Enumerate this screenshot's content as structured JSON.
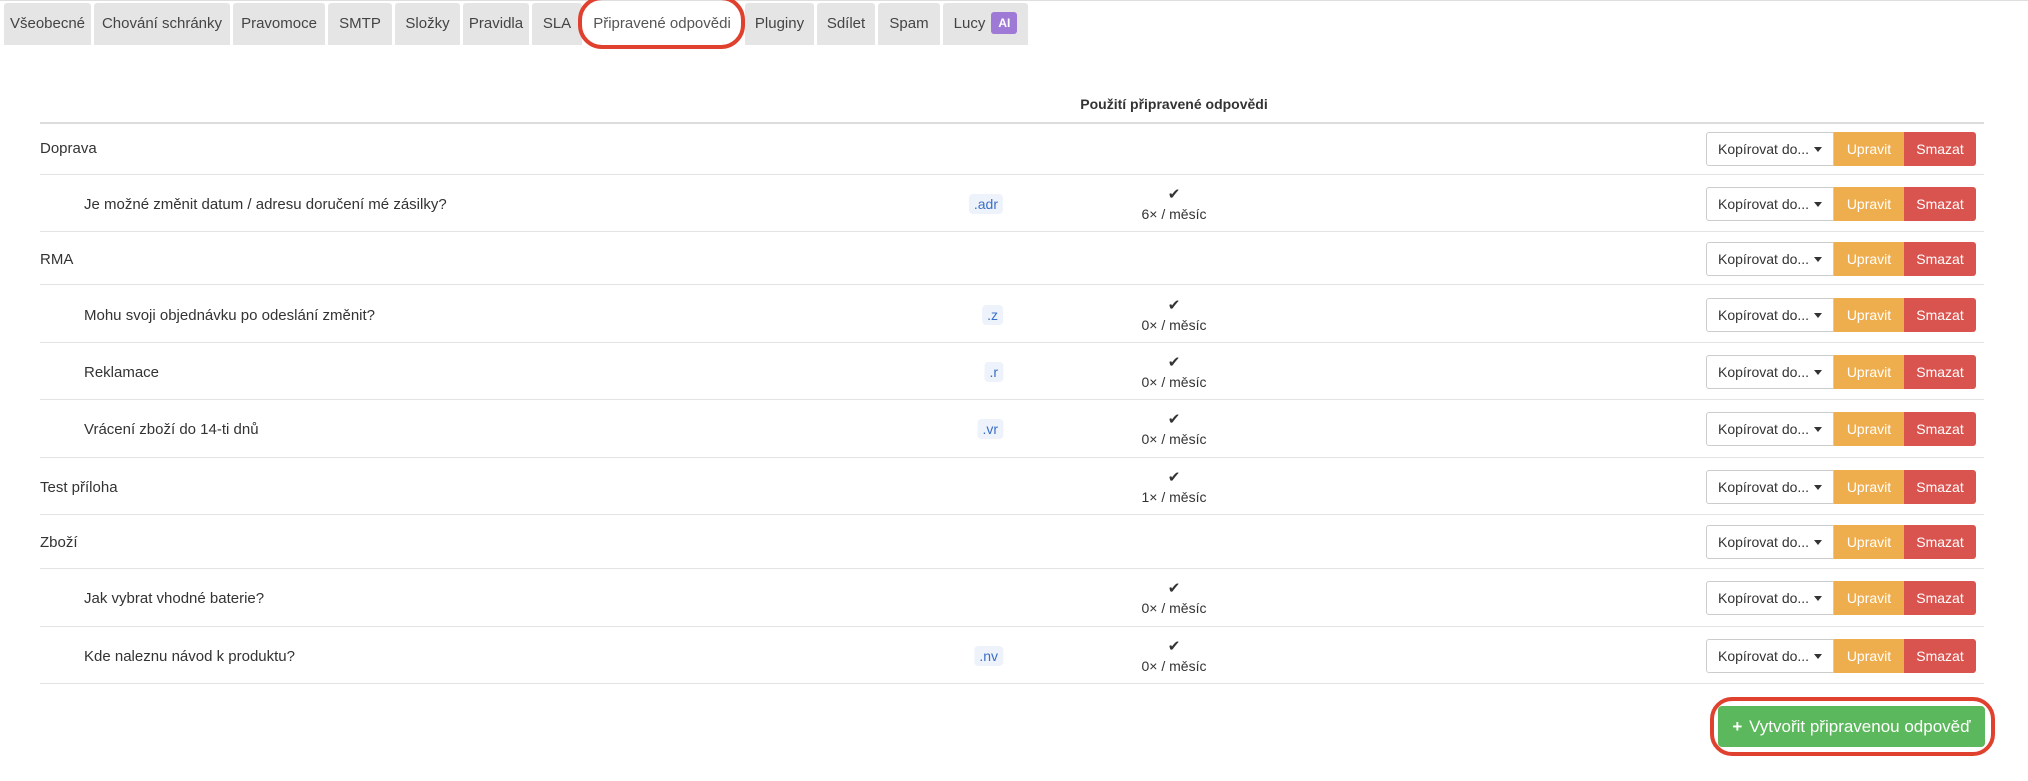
{
  "tabs": [
    {
      "label": "Všeobecné"
    },
    {
      "label": "Chování schránky"
    },
    {
      "label": "Pravomoce"
    },
    {
      "label": "SMTP"
    },
    {
      "label": "Složky"
    },
    {
      "label": "Pravidla"
    },
    {
      "label": "SLA"
    },
    {
      "label": "Připravené odpovědi",
      "active": true
    },
    {
      "label": "Pluginy"
    },
    {
      "label": "Sdílet"
    },
    {
      "label": "Spam"
    },
    {
      "label": "Lucy",
      "badge": "AI"
    }
  ],
  "table": {
    "usage_header": "Použití připravené odpovědi",
    "rows": [
      {
        "name": "Doprava",
        "indent": false,
        "shortcut": "",
        "check": "",
        "usage": ""
      },
      {
        "name": "Je možné změnit datum / adresu doručení mé zásilky?",
        "indent": true,
        "shortcut": ".adr",
        "check": "✔",
        "usage": "6× / měsíc"
      },
      {
        "name": "RMA",
        "indent": false,
        "shortcut": "",
        "check": "",
        "usage": ""
      },
      {
        "name": "Mohu svoji objednávku po odeslání změnit?",
        "indent": true,
        "shortcut": ".z",
        "check": "✔",
        "usage": "0× / měsíc"
      },
      {
        "name": "Reklamace",
        "indent": true,
        "shortcut": ".r",
        "check": "✔",
        "usage": "0× / měsíc"
      },
      {
        "name": "Vrácení zboží do 14-ti dnů",
        "indent": true,
        "shortcut": ".vr",
        "check": "✔",
        "usage": "0× / měsíc"
      },
      {
        "name": "Test příloha",
        "indent": false,
        "shortcut": "",
        "check": "✔",
        "usage": "1× / měsíc"
      },
      {
        "name": "Zboží",
        "indent": false,
        "shortcut": "",
        "check": "",
        "usage": ""
      },
      {
        "name": "Jak vybrat vhodné baterie?",
        "indent": true,
        "shortcut": "",
        "check": "✔",
        "usage": "0× / měsíc"
      },
      {
        "name": "Kde naleznu návod k produktu?",
        "indent": true,
        "shortcut": ".nv",
        "check": "✔",
        "usage": "0× / měsíc"
      }
    ]
  },
  "buttons": {
    "copy_label": "Kopírovat do...",
    "edit_label": "Upravit",
    "delete_label": "Smazat",
    "create_label": "Vytvořit připravenou odpověď"
  },
  "icons": {
    "create": "plus-icon",
    "copy_dropdown": "caret-down-icon",
    "usage": "check-icon"
  },
  "colors": {
    "edit": "#efae4e",
    "delete": "#d9534f",
    "create": "#5cb85c",
    "highlight": "#e0412f",
    "ai_badge": "#9e79d6"
  }
}
